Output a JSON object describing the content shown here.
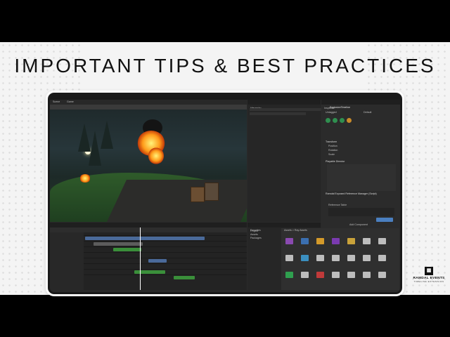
{
  "slide": {
    "heading": "IMPORTANT TIPS & BEST PRACTICES"
  },
  "logo": {
    "name": "RAMDAL EVENTS",
    "subtitle": "TIMELINE EXTENSION",
    "icon": "film-icon"
  },
  "editor": {
    "tabs": {
      "scene": "Scene",
      "game": "Game",
      "hierarchy": "Hierarchy",
      "inspector": "Inspector",
      "project": "Project",
      "timeline": "Timeline"
    },
    "inspector": {
      "object_name": "ExplosionTimeline",
      "tag": "Untagged",
      "layer": "Default",
      "transform": "Transform",
      "position": "Position",
      "rotation": "Rotation",
      "scale": "Scale",
      "playable_director": "Playable Director",
      "manager": "Ramdal Exposed Reference Manager (Script)",
      "reference_table": "Reference Table",
      "add_component": "Add Component"
    },
    "project": {
      "favorites": "Favorites",
      "assets": "Assets",
      "packages": "Packages",
      "breadcrumb": "Assets > Ray Assets"
    },
    "colors": {
      "accent": "#4a7fc0",
      "fire": "#ff9b1a",
      "track_green": "#3a8f3a"
    }
  }
}
